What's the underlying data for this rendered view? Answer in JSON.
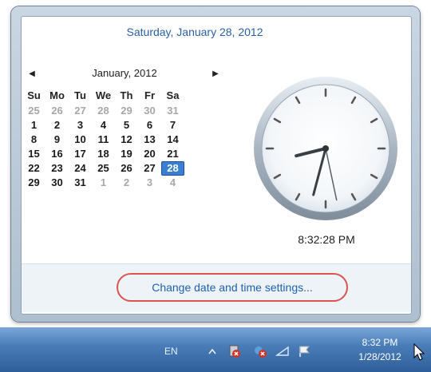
{
  "flyout": {
    "long_date": "Saturday, January 28, 2012",
    "calendar": {
      "month_title": "January, 2012",
      "weekdays": [
        "Su",
        "Mo",
        "Tu",
        "We",
        "Th",
        "Fr",
        "Sa"
      ],
      "weeks": [
        [
          "25",
          "26",
          "27",
          "28",
          "29",
          "30",
          "31"
        ],
        [
          "1",
          "2",
          "3",
          "4",
          "5",
          "6",
          "7"
        ],
        [
          "8",
          "9",
          "10",
          "11",
          "12",
          "13",
          "14"
        ],
        [
          "15",
          "16",
          "17",
          "18",
          "19",
          "20",
          "21"
        ],
        [
          "22",
          "23",
          "24",
          "25",
          "26",
          "27",
          "28"
        ],
        [
          "29",
          "30",
          "31",
          "1",
          "2",
          "3",
          "4"
        ]
      ],
      "selected_day": "28"
    },
    "clock_time": "8:32:28 PM",
    "settings_link": "Change date and time settings...",
    "accent_color": "#3b7fd0",
    "highlight_color": "#d9534f"
  },
  "taskbar": {
    "language": "EN",
    "tray_icons": [
      "show-hidden-icons-arrow",
      "action-center-flag",
      "network-icon",
      "volume-icon",
      "battery-icon"
    ],
    "time": "8:32 PM",
    "date": "1/28/2012"
  }
}
